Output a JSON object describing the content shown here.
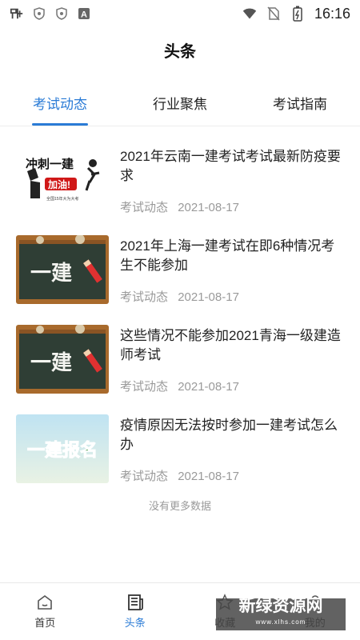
{
  "status": {
    "time": "16:16"
  },
  "header": {
    "title": "头条"
  },
  "tabs": [
    {
      "label": "考试动态",
      "active": true
    },
    {
      "label": "行业聚焦",
      "active": false
    },
    {
      "label": "考试指南",
      "active": false
    }
  ],
  "articles": [
    {
      "title": "2021年云南一建考试考试最新防疫要求",
      "category": "考试动态",
      "date": "2021-08-17",
      "thumb": "slogan"
    },
    {
      "title": "2021年上海一建考试在即6种情况考生不能参加",
      "category": "考试动态",
      "date": "2021-08-17",
      "thumb": "chalkboard"
    },
    {
      "title": "这些情况不能参加2021青海一级建造师考试",
      "category": "考试动态",
      "date": "2021-08-17",
      "thumb": "chalkboard"
    },
    {
      "title": "疫情原因无法按时参加一建考试怎么办",
      "category": "考试动态",
      "date": "2021-08-17",
      "thumb": "signup"
    }
  ],
  "thumb_text": {
    "chalk": "一建",
    "signup": "一建报名",
    "slogan_main": "冲刺一建",
    "slogan_sub": "加油!",
    "slogan_small": "全国15年大为大考"
  },
  "footer_note": "没有更多数据",
  "bottom_nav": [
    {
      "label": "首页",
      "icon": "home-icon"
    },
    {
      "label": "头条",
      "icon": "news-icon"
    },
    {
      "label": "收藏",
      "icon": "star-icon"
    },
    {
      "label": "我的",
      "icon": "user-icon"
    }
  ],
  "watermark": {
    "main": "新绿资源网",
    "sub": "www.xlhs.com"
  },
  "colors": {
    "accent": "#2a7bd6"
  }
}
